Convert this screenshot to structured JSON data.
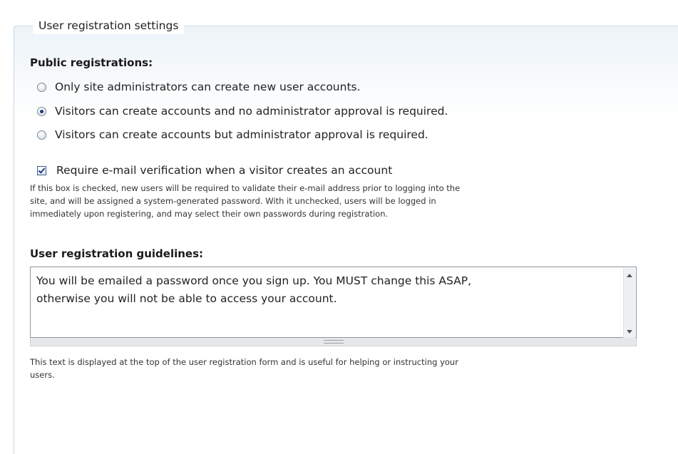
{
  "fieldset": {
    "legend": "User registration settings"
  },
  "public_registrations": {
    "label": "Public registrations:",
    "options": [
      {
        "label": "Only site administrators can create new user accounts.",
        "selected": false
      },
      {
        "label": "Visitors can create accounts and no administrator approval is required.",
        "selected": true
      },
      {
        "label": "Visitors can create accounts but administrator approval is required.",
        "selected": false
      }
    ]
  },
  "email_verification": {
    "label": "Require e-mail verification when a visitor creates an account",
    "checked": true,
    "description_lines": [
      "If this box is checked, new users will be required to validate their e-mail address prior to logging into the",
      "site, and will be assigned a system-generated password. With it unchecked, users will be logged in",
      "immediately upon registering, and may select their own passwords during registration."
    ]
  },
  "guidelines": {
    "label": "User registration guidelines:",
    "text_lines": [
      "You will be emailed a password once you sign up.  You MUST change this ASAP,",
      "otherwise you will not be able to access your account."
    ],
    "description_lines": [
      "This text is displayed at the top of the user registration form and is useful for helping or instructing your",
      "users."
    ]
  },
  "icons": {
    "radio": "radio-button-icon",
    "checkbox": "checkbox-icon",
    "scroll_up": "scroll-up-arrow-icon",
    "scroll_down": "scroll-down-arrow-icon",
    "resize": "resize-grip-icon"
  }
}
